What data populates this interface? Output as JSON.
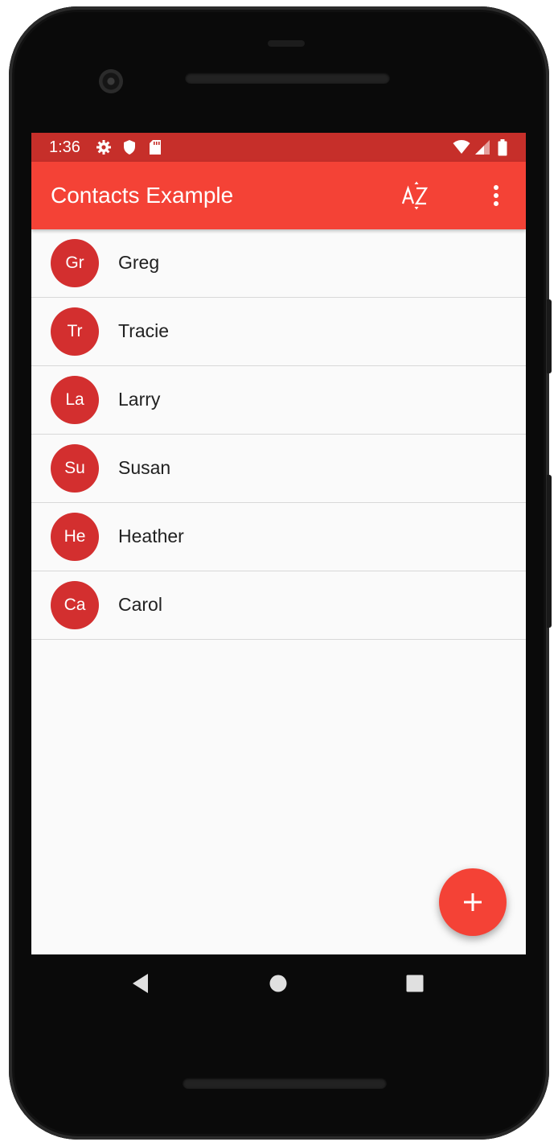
{
  "status_bar": {
    "time": "1:36",
    "left_icons": [
      "gear-icon",
      "shield-icon",
      "sd-card-icon"
    ],
    "right_icons": [
      "wifi-icon",
      "signal-icon",
      "battery-icon"
    ]
  },
  "app_bar": {
    "title": "Contacts Example",
    "sort_icon": "sort-az-icon",
    "menu_icon": "more-vert-icon"
  },
  "contacts": [
    {
      "initials": "Gr",
      "name": "Greg"
    },
    {
      "initials": "Tr",
      "name": "Tracie"
    },
    {
      "initials": "La",
      "name": "Larry"
    },
    {
      "initials": "Su",
      "name": "Susan"
    },
    {
      "initials": "He",
      "name": "Heather"
    },
    {
      "initials": "Ca",
      "name": "Carol"
    }
  ],
  "fab": {
    "icon": "plus-icon"
  },
  "nav_bar": {
    "icons": [
      "back-icon",
      "home-icon",
      "recents-icon"
    ]
  },
  "colors": {
    "status_bar": "#c62f2a",
    "app_bar": "#f44236",
    "avatar": "#d32f2f",
    "fab": "#f44236",
    "background": "#fafafa"
  }
}
